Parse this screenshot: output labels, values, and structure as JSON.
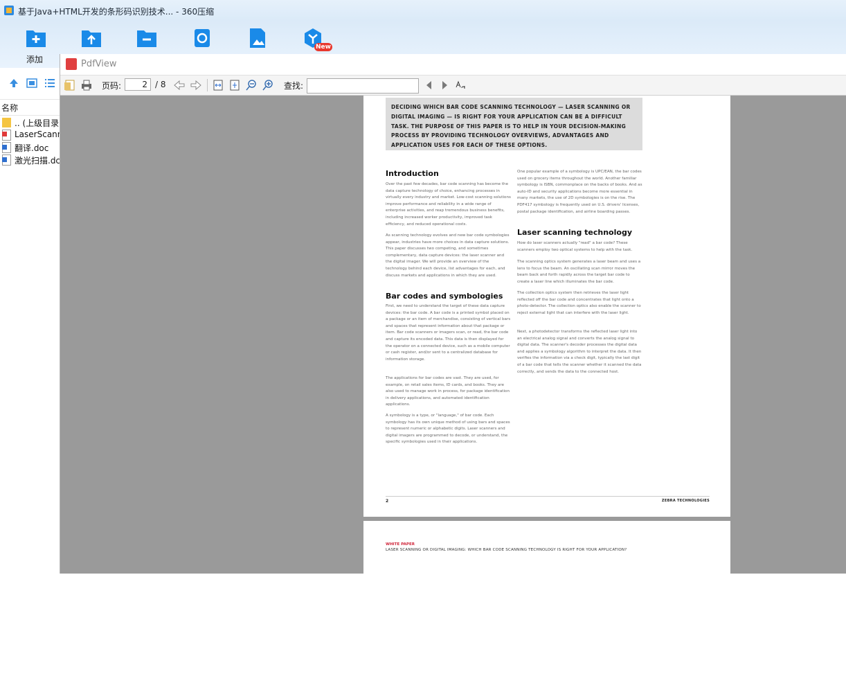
{
  "window": {
    "title": "基于Java+HTML开发的条形码识别技术... - 360压缩",
    "app_icon": "360zip-icon"
  },
  "toolbar": {
    "add_label": "添加",
    "buttons": [
      "add-icon",
      "extract-icon",
      "delete-icon",
      "scan-icon",
      "zip-image-icon",
      "new-feature-icon"
    ],
    "new_badge": "New"
  },
  "sidebar": {
    "column_header": "名称",
    "files": [
      {
        "name": ".. (上级目录)",
        "icon": "folder-icon"
      },
      {
        "name": "LaserScann",
        "icon": "pdf-file-icon"
      },
      {
        "name": "翻译.doc",
        "icon": "doc-file-icon"
      },
      {
        "name": "激光扫描.dc",
        "icon": "doc-file-icon"
      }
    ]
  },
  "pdfview": {
    "title": "PdfView",
    "page_label": "页码:",
    "current_page": "2",
    "total_pages": "/ 8",
    "find_label": "查找:",
    "find_value": ""
  },
  "document": {
    "callout": "DECIDING WHICH BAR CODE SCANNING TECHNOLOGY — LASER SCANNING OR DIGITAL IMAGING — IS RIGHT FOR YOUR APPLICATION CAN BE A DIFFICULT TASK. THE PURPOSE OF THIS PAPER IS TO HELP IN YOUR DECISION-MAKING PROCESS BY PROVIDING TECHNOLOGY OVERVIEWS, ADVANTAGES AND APPLICATION USES FOR EACH OF THESE OPTIONS.",
    "intro_heading": "Introduction",
    "intro_p1": "Over the past few decades, bar code scanning has become the data capture technology of choice, enhancing processes in virtually every industry and market. Low-cost scanning solutions improve performance and reliability in a wide range of enterprise activities, and reap tremendous business benefits, including increased worker productivity, improved task efficiency, and reduced operational costs.",
    "intro_p2": "As scanning technology evolves and new bar code symbologies appear, industries have more choices in data capture solutions. This paper discusses two competing, and sometimes complementary, data capture devices: the laser scanner and the digital imager. We will provide an overview of the technology behind each device, list advantages for each, and discuss markets and applications in which they are used.",
    "barcodes_heading": "Bar codes and symbologies",
    "barcodes_p1": "First, we need to understand the target of these data capture devices: the bar code. A bar code is a printed symbol placed on a package or an item of merchandise, consisting of vertical bars and spaces that represent information about that package or item. Bar code scanners or imagers scan, or read, the bar code and capture its encoded data. This data is then displayed for the operator on a connected device, such as a mobile computer or cash register, and/or sent to a centralized database for information storage.",
    "barcodes_p2": "The applications for bar codes are vast. They are used, for example, on retail sales items, ID cards, and books. They are also used to manage work in process, for package identification in delivery applications, and automated identification applications.",
    "barcodes_p3": "A symbology is a type, or \"language,\" of bar code. Each symbology has its own unique method of using bars and spaces to represent numeric or alphabetic digits. Laser scanners and digital imagers are programmed to decode, or understand, the specific symbologies used in their applications.",
    "col2_p1": "One popular example of a symbology is UPC/EAN, the bar codes used on grocery items throughout the world. Another familiar symbology is ISBN, commonplace on the backs of books. And as auto-ID and security applications become more essential in many markets, the use of 2D symbologies is on the rise. The PDF417 symbology is frequently used on U.S. drivers' licenses, postal package identification, and airline boarding passes.",
    "laser_heading": "Laser scanning technology",
    "laser_p1": "How do laser scanners actually \"read\" a bar code? These scanners employ two optical systems to help with the task.",
    "laser_p2": "The scanning optics system generates a laser beam and uses a lens to focus the beam. An oscillating scan mirror moves the beam back and forth rapidly across the target bar code to create a laser line which illuminates the bar code.",
    "laser_p3": "The collection optics system then retrieves the laser light reflected off the bar code and concentrates that light onto a photo-detector. The collection optics also enable the scanner to reject external light that can interfere with the laser light.",
    "laser_p4": "Next, a photodetector transforms the reflected laser light into an electrical analog signal and converts the analog signal to digital data. The scanner's decoder processes the digital data and applies a symbology algorithm to interpret the data. It then verifies the information via a check digit, typically the last digit of a bar code that tells the scanner whether it scanned the data correctly, and sends the data to the connected host.",
    "page_number": "2",
    "brand": "ZEBRA TECHNOLOGIES",
    "next_page_label": "WHITE PAPER",
    "next_page_subtitle": "LASER SCANNING OR DIGITAL IMAGING: WHICH BAR CODE SCANNING TECHNOLOGY IS RIGHT FOR YOUR APPLICATION?"
  }
}
